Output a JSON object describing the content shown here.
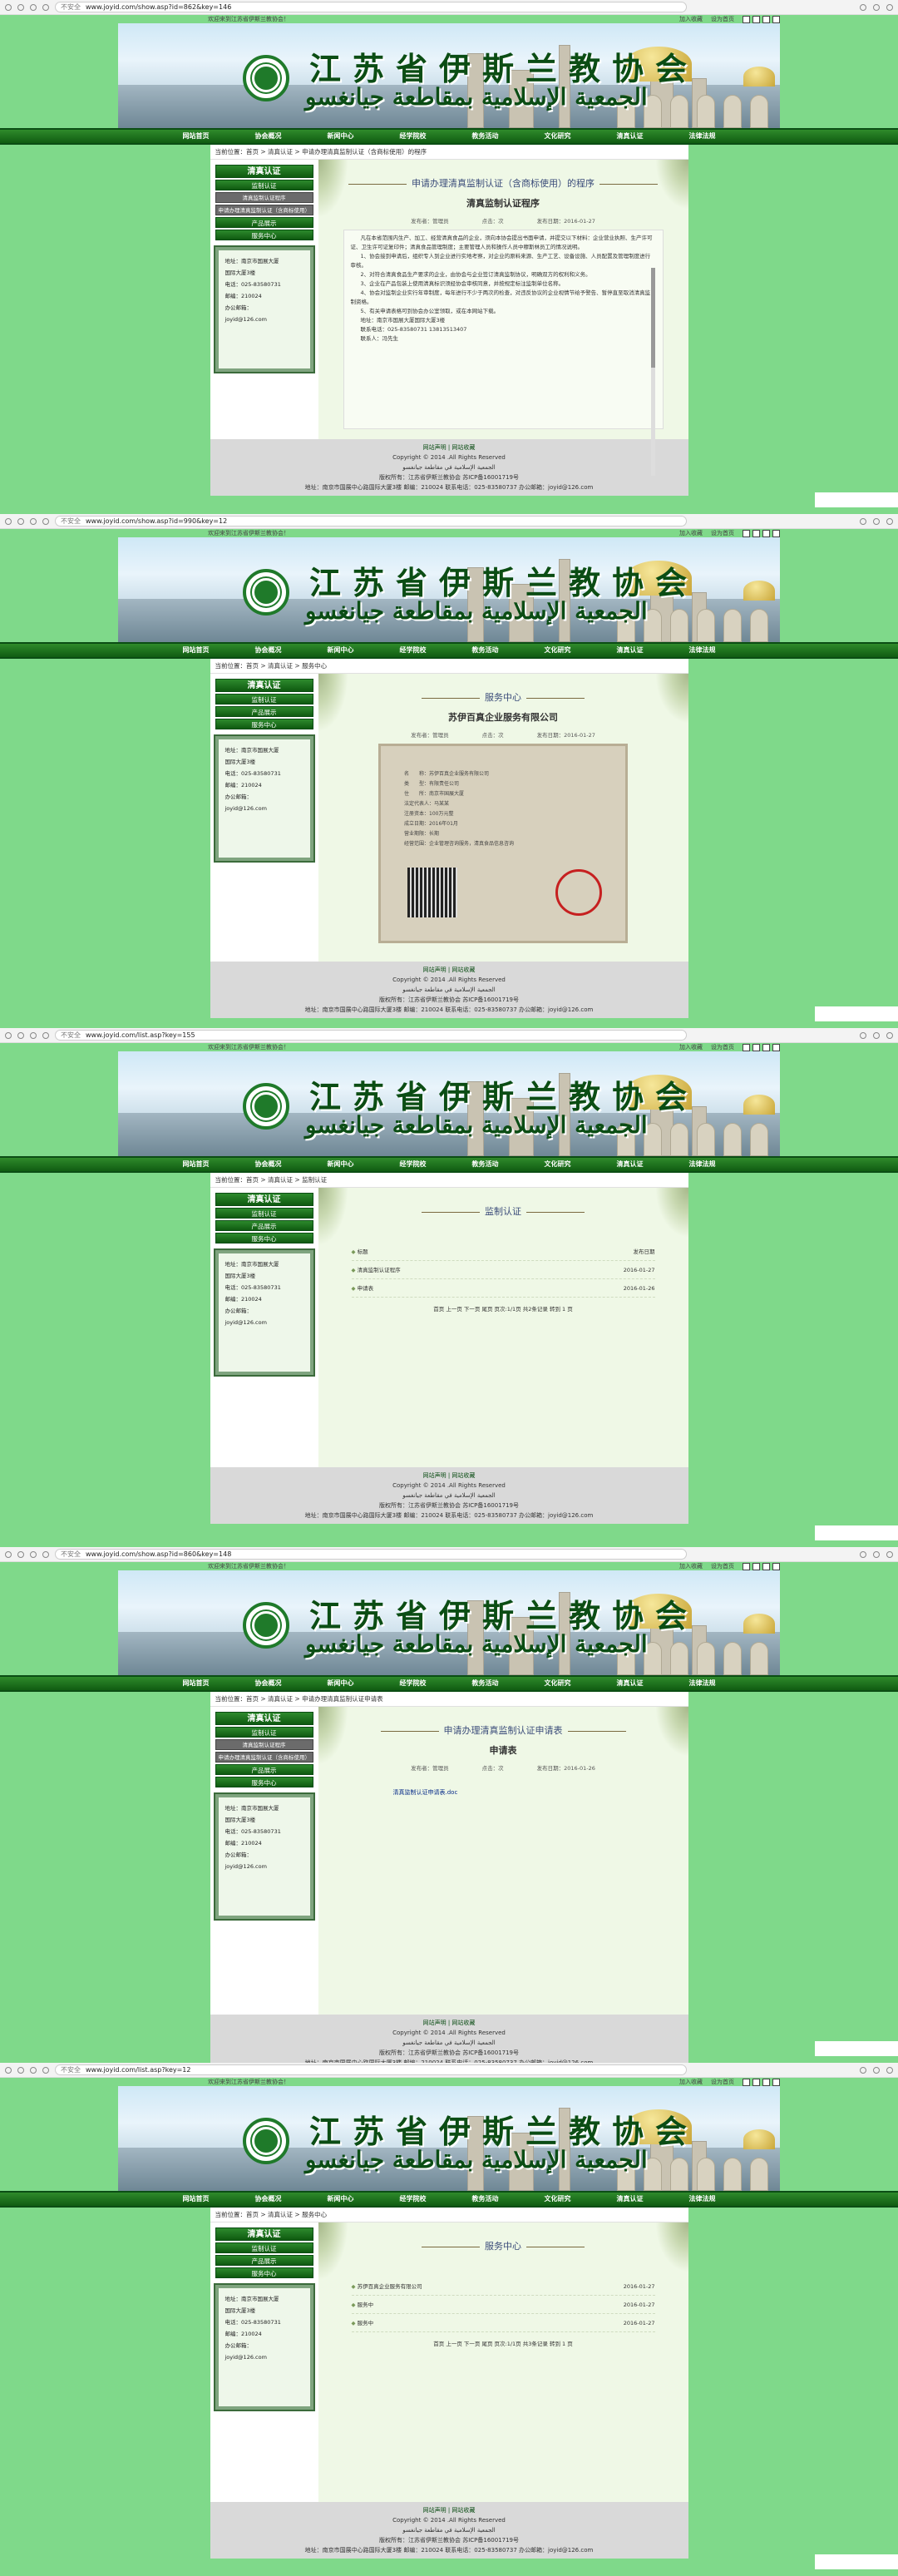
{
  "browser": {
    "secure_label": "不安全",
    "urls": [
      "www.joyid.com/show.asp?id=862&key=146",
      "www.joyid.com/show.asp?id=990&key=12",
      "www.joyid.com/list.asp?key=155",
      "www.joyid.com/show.asp?id=860&key=148",
      "www.joyid.com/list.asp?key=12"
    ]
  },
  "topstrip": {
    "welcome": "欢迎来到江苏省伊斯兰教协会！",
    "login": "加入收藏",
    "home": "设为首页"
  },
  "header": {
    "title_cn": "江苏省伊斯兰教协会",
    "title_ar": "الجمعية الإسلامية بمقاطعة جيانغسو"
  },
  "nav": {
    "items": [
      "网站首页",
      "协会概况",
      "新闻中心",
      "经学院校",
      "教务活动",
      "文化研究",
      "清真认证",
      "法律法规"
    ]
  },
  "sidebar": {
    "heading": "清真认证",
    "items": [
      "监制认证",
      "清真监制认证程序",
      "申请办理清真监制认证（含商标使用）",
      "产品展示",
      "服务中心"
    ],
    "items_b": [
      "清真认证",
      "监制认证",
      "产品展示",
      "服务中心"
    ],
    "contact": {
      "address": "地址：南京市国展大厦",
      "address2": "国际大厦3楼",
      "tel": "电话：025-83580731",
      "post": "邮编：210024",
      "email_label": "办公邮箱：",
      "email": "joyid@126.com"
    }
  },
  "pages": [
    {
      "breadcrumb": "当前位置：首页 > 清真认证 > 申请办理清真监制认证（含商标使用）的程序",
      "head": "申请办理清真监制认证（含商标使用）的程序",
      "title": "清真监制认证程序",
      "meta": [
        "发布者：管理员",
        "点击：次",
        "发布日期：2016-01-27"
      ],
      "article": [
        "凡在本省范围内生产、加工、经营清真食品的企业，须向本协会提出书面申请，并提交以下材料：企业营业执照、生产许可证、卫生许可证复印件；清真食品管理制度；主要管理人员和操作人员中穆斯林员工的情况说明。",
        "1、协会接到申请后，组织专人到企业进行实地考察，对企业的原料来源、生产工艺、设备设施、人员配置及管理制度进行审核。",
        "2、对符合清真食品生产要求的企业，由协会与企业签订清真监制协议，明确双方的权利和义务。",
        "3、企业在产品包装上使用清真标识须经协会审核同意，并按规定标注监制单位名称。",
        "4、协会对监制企业实行年审制度，每年进行不少于两次的检查，对违反协议的企业视情节给予警告、暂停直至取消清真监制资格。",
        "5、有关申请表格可到协会办公室领取，或在本网站下载。",
        "地址：南京市国展大厦国际大厦3楼",
        "联系电话：025-83580731 13813513407",
        "联系人：冯先生"
      ]
    },
    {
      "breadcrumb": "当前位置：首页 > 清真认证 > 服务中心",
      "head": "服务中心",
      "title": "苏伊百真企业服务有限公司",
      "meta": [
        "发布者：管理员",
        "点击：次",
        "发布日期：2016-01-27"
      ],
      "license_lines": [
        "名　　称：苏伊百真企业服务有限公司",
        "类　　型：有限责任公司",
        "住　　所：南京市国展大厦",
        "法定代表人：马某某",
        "注册资本：100万元整",
        "成立日期：2016年01月",
        "营业期限：长期",
        "经营范围：企业管理咨询服务，清真食品信息咨询"
      ],
      "license_stamp": "登记机关"
    },
    {
      "breadcrumb": "当前位置：首页 > 清真认证 > 监制认证",
      "head": "监制认证",
      "list_header": [
        "标题",
        "发布日期"
      ],
      "list": [
        {
          "title": "清真监制认证程序",
          "date": "2016-01-27"
        },
        {
          "title": "申请表",
          "date": "2016-01-26"
        }
      ],
      "pager": "首页 上一页 下一页 尾页 页次:1/1页 共2条记录 转到 1 页"
    },
    {
      "breadcrumb": "当前位置：首页 > 清真认证 > 申请办理清真监制认证申请表",
      "head": "申请办理清真监制认证申请表",
      "title": "申请表",
      "meta": [
        "发布者：管理员",
        "点击：次",
        "发布日期：2016-01-26"
      ],
      "attachment": "清真监制认证申请表.doc"
    },
    {
      "breadcrumb": "当前位置：首页 > 清真认证 > 服务中心",
      "head": "服务中心",
      "list": [
        {
          "title": "苏伊百真企业服务有限公司",
          "date": "2016-01-27"
        },
        {
          "title": "服务中",
          "date": "2016-01-27"
        },
        {
          "title": "服务中",
          "date": "2016-01-27"
        }
      ],
      "pager": "首页 上一页 下一页 尾页 页次:1/1页 共3条记录 转到 1 页"
    }
  ],
  "footer": {
    "links": "网站声明 | 网站收藏",
    "copyright": "Copyright © 2014 .All Rights Reserved",
    "org_ar": "الجمعية الإسلامية في مقاطعة جيانغسو",
    "icp": "版权所有：江苏省伊斯兰教协会 苏ICP备16001719号",
    "address": "地址：南京市国展中心路国际大厦3楼 邮编：210024 联系电话：025-83580737 办公邮箱：joyid@126.com"
  }
}
